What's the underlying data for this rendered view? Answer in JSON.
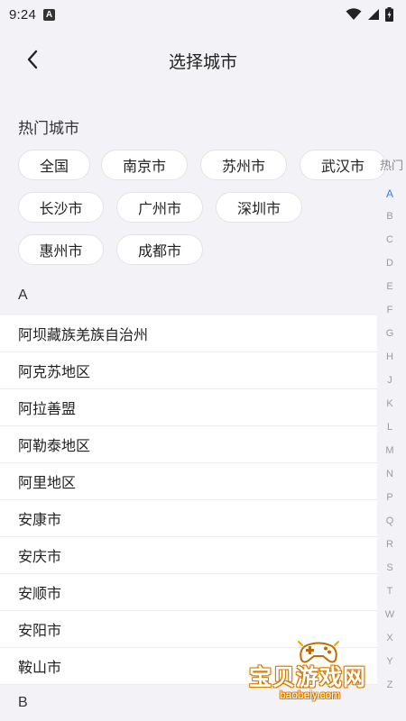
{
  "status_bar": {
    "time": "9:24",
    "notification_glyph": "A"
  },
  "header": {
    "title": "选择城市",
    "back_icon": "chevron-left-icon"
  },
  "hot": {
    "label": "热门城市",
    "cities": [
      "全国",
      "南京市",
      "苏州市",
      "武汉市",
      "长沙市",
      "广州市",
      "深圳市",
      "惠州市",
      "成都市"
    ]
  },
  "sections": [
    {
      "letter": "A",
      "cities": [
        "阿坝藏族羌族自治州",
        "阿克苏地区",
        "阿拉善盟",
        "阿勒泰地区",
        "阿里地区",
        "安康市",
        "安庆市",
        "安顺市",
        "安阳市",
        "鞍山市"
      ]
    },
    {
      "letter": "B"
    }
  ],
  "index_bar": {
    "hot_label": "热门",
    "letters": [
      "A",
      "B",
      "C",
      "D",
      "E",
      "F",
      "G",
      "H",
      "J",
      "K",
      "L",
      "M",
      "N",
      "P",
      "Q",
      "R",
      "S",
      "T",
      "W",
      "X",
      "Y",
      "Z"
    ],
    "active": "A",
    "active_color": "#3b7cff"
  },
  "watermark": {
    "text": "宝贝游戏网",
    "url": "baobeiy.com"
  }
}
